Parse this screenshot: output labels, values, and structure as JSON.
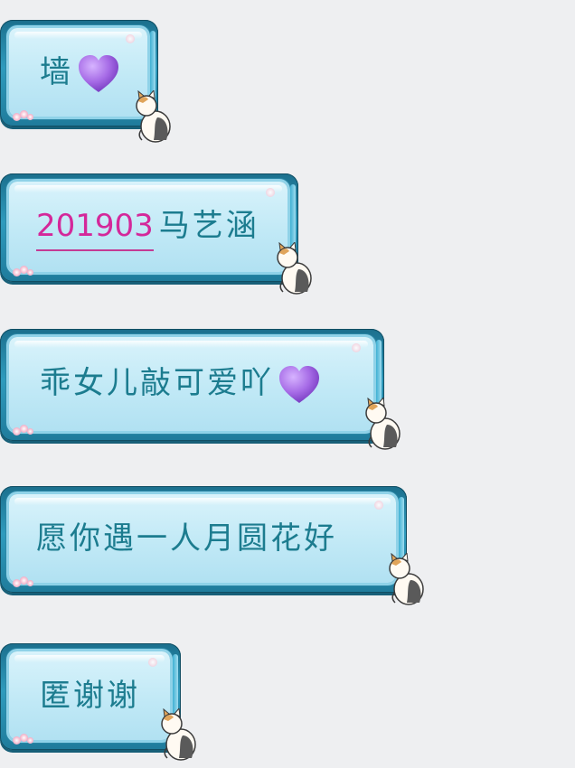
{
  "messages": [
    {
      "text": "墙",
      "emoji": "purple-heart"
    },
    {
      "link": "201903",
      "text": "马艺涵"
    },
    {
      "text": "乖女儿敲可爱吖",
      "emoji": "purple-heart"
    },
    {
      "text": "愿你遇一人月圆花好"
    },
    {
      "text": "匿谢谢"
    }
  ],
  "colors": {
    "background": "#eeeff1",
    "bubble_frame": "#2f9bbd",
    "bubble_fill": "#c1e9f6",
    "text": "#1c7c8f",
    "link": "#d4289a",
    "heart": "#a66be6"
  }
}
